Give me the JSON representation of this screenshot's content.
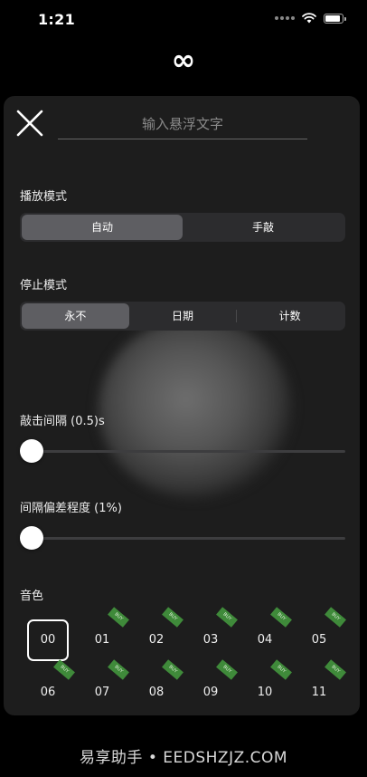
{
  "status_bar": {
    "time": "1:21"
  },
  "header": {
    "logo": "∞"
  },
  "panel": {
    "input": {
      "placeholder": "输入悬浮文字",
      "value": ""
    },
    "play_mode": {
      "label": "播放模式",
      "options": [
        "自动",
        "手敲"
      ],
      "selected": "自动"
    },
    "stop_mode": {
      "label": "停止模式",
      "options": [
        "永不",
        "日期",
        "计数"
      ],
      "selected": "永不"
    },
    "tap_interval": {
      "label": "敲击间隔 (0.5)s",
      "value": 0.0
    },
    "interval_deviation": {
      "label": "间隔偏差程度 (1%)",
      "value": 0.0
    },
    "tone": {
      "label": "音色",
      "items": [
        {
          "label": "00",
          "selected": true,
          "badge": ""
        },
        {
          "label": "01",
          "selected": false,
          "badge": "BUY"
        },
        {
          "label": "02",
          "selected": false,
          "badge": "BUY"
        },
        {
          "label": "03",
          "selected": false,
          "badge": "BUY"
        },
        {
          "label": "04",
          "selected": false,
          "badge": "BUY"
        },
        {
          "label": "05",
          "selected": false,
          "badge": "BUY"
        },
        {
          "label": "06",
          "selected": false,
          "badge": "BUY"
        },
        {
          "label": "07",
          "selected": false,
          "badge": "BUY"
        },
        {
          "label": "08",
          "selected": false,
          "badge": "BUY"
        },
        {
          "label": "09",
          "selected": false,
          "badge": "BUY"
        },
        {
          "label": "10",
          "selected": false,
          "badge": "BUY"
        },
        {
          "label": "11",
          "selected": false,
          "badge": "BUY"
        }
      ]
    }
  },
  "watermark": "易享助手 • EEDSHZJZ.COM",
  "colors": {
    "background": "#000000",
    "panel": "#1d1d1d",
    "segment_bg": "#2c2c2e",
    "segment_selected": "#5e5e62",
    "badge": "#3f8a3a"
  },
  "icons": [
    "signal-dots-icon",
    "wifi-icon",
    "battery-icon",
    "close-icon"
  ]
}
